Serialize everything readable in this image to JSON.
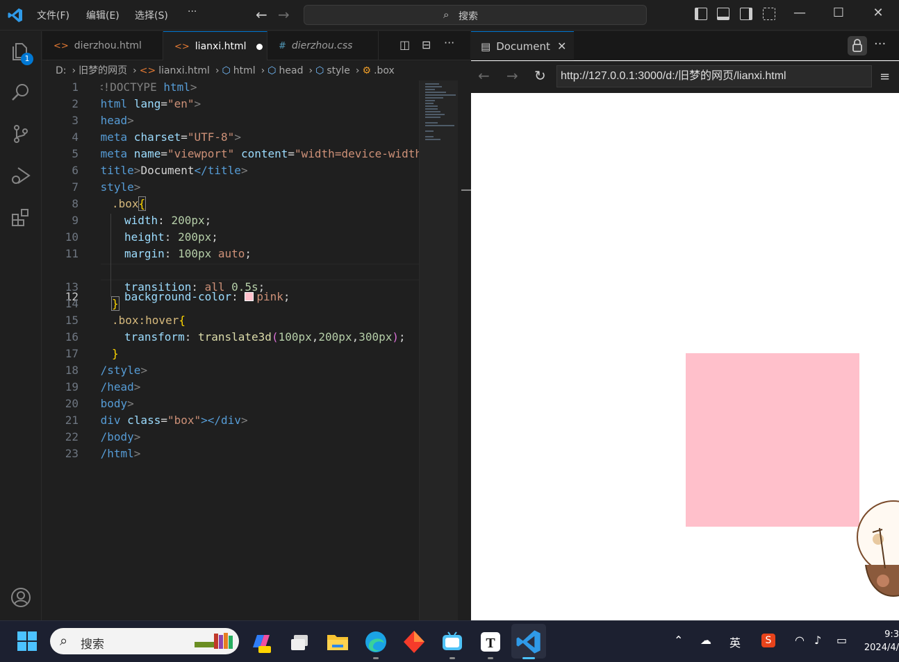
{
  "titlebar": {
    "menus": [
      "文件(F)",
      "编辑(E)",
      "选择(S)",
      "···"
    ],
    "search_placeholder": "搜索"
  },
  "activity": {
    "scm_badge": "1"
  },
  "tabs": [
    {
      "label": "dierzhou.html",
      "kind": "html",
      "active": false
    },
    {
      "label": "lianxi.html",
      "kind": "html",
      "active": true,
      "modified": true
    },
    {
      "label": "dierzhou.css",
      "kind": "css",
      "active": false
    }
  ],
  "breadcrumb": [
    "D:",
    "旧梦的网页",
    "lianxi.html",
    "html",
    "head",
    "style",
    ".box"
  ],
  "code": {
    "current_line": 12,
    "lines": [
      "1",
      "2",
      "3",
      "4",
      "5",
      "6",
      "7",
      "8",
      "9",
      "10",
      "11",
      "12",
      "13",
      "14",
      "15",
      "16",
      "17",
      "18",
      "19",
      "20",
      "21",
      "22",
      "23"
    ],
    "tokens": {
      "l1": [
        "<!DOCTYPE",
        " html",
        ">"
      ],
      "l2": [
        "<html",
        " lang",
        "=",
        "\"en\"",
        ">"
      ],
      "l3": [
        "<head",
        ">"
      ],
      "l4": [
        "<meta",
        " charset",
        "=",
        "\"UTF-8\"",
        ">"
      ],
      "l5": [
        "<meta",
        " name",
        "=",
        "\"viewport\"",
        " content",
        "=",
        "\"width=device-width"
      ],
      "l6": [
        "<title",
        ">",
        "Document",
        "</title",
        ">"
      ],
      "l7": [
        "<style",
        ">"
      ],
      "l8": [
        ".box",
        "{"
      ],
      "l9": [
        "width",
        ": ",
        "200px",
        ";"
      ],
      "l10": [
        "height",
        ": ",
        "200px",
        ";"
      ],
      "l11": [
        "margin",
        ": ",
        "100px",
        " auto",
        ";"
      ],
      "l12": [
        "background-color",
        ": ",
        "pink",
        ";"
      ],
      "l13": [
        "transition",
        ": ",
        "all",
        " ",
        "0.5s",
        ";"
      ],
      "l14": [
        "}"
      ],
      "l15": [
        ".box:hover",
        "{"
      ],
      "l16": [
        "transform",
        ": ",
        "translate3d",
        "(",
        "100px",
        ",",
        "200px",
        ",",
        "300px",
        ")",
        ";"
      ],
      "l17": [
        "}"
      ],
      "l18": [
        "</style",
        ">"
      ],
      "l19": [
        "</head",
        ">"
      ],
      "l20": [
        "<body",
        ">"
      ],
      "l21": [
        "<div",
        " class",
        "=",
        "\"box\"",
        "></div",
        ">"
      ],
      "l22": [
        "</body",
        ">"
      ],
      "l23": [
        "</html",
        ">"
      ]
    }
  },
  "browser": {
    "tab_title": "Document",
    "url": "http://127.0.0.1:3000/d:/旧梦的网页/lianxi.html",
    "box_color": "#ffc0cb"
  },
  "taskbar": {
    "search_placeholder": "搜索",
    "ime": "英",
    "clock_time": "9:3",
    "clock_date": "2024/4/"
  }
}
